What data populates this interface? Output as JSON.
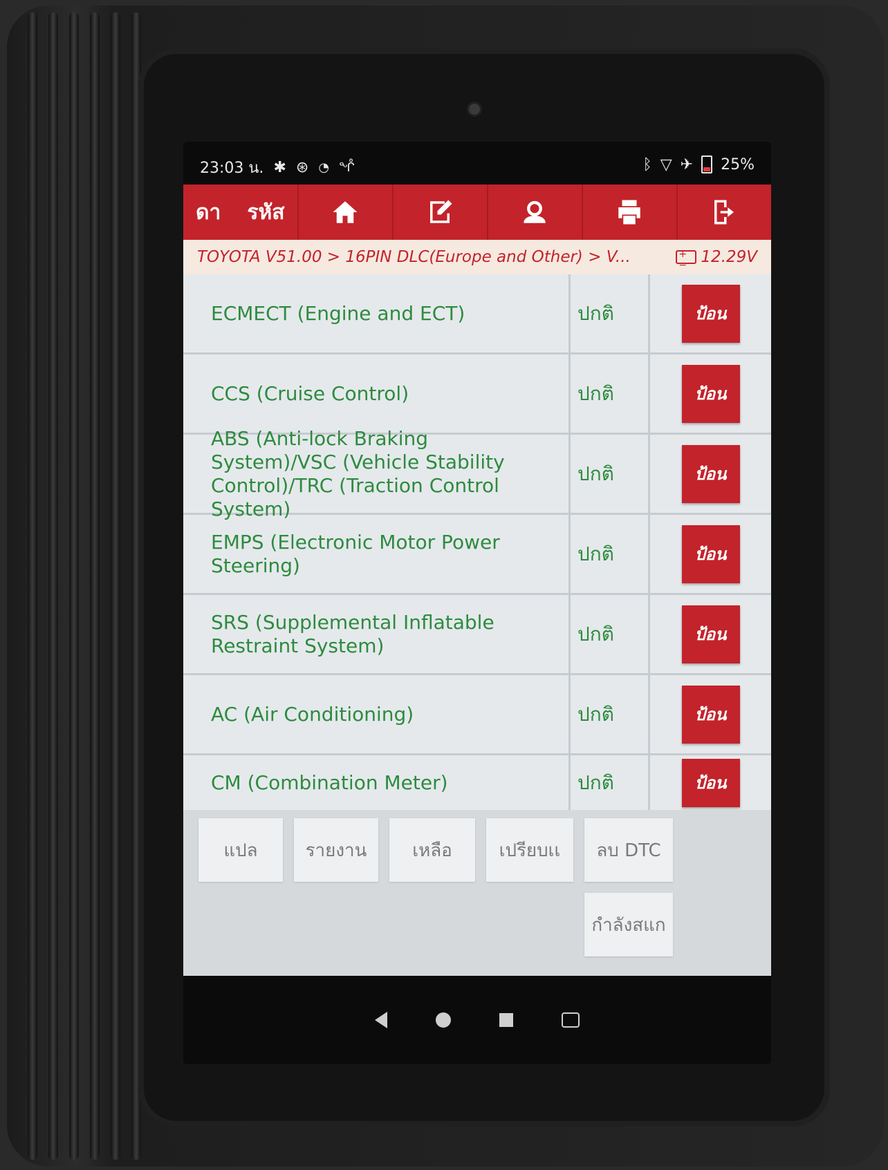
{
  "status": {
    "time": "23:03 น.",
    "battery": "25%",
    "icons_left": [
      "gear-icon",
      "steering-icon",
      "wifi-icon",
      "stethoscope-icon"
    ],
    "icons_right": [
      "bluetooth-icon",
      "signal-icon",
      "airplane-icon",
      "battery-icon"
    ]
  },
  "toolbar": {
    "left_label_1": "ดา",
    "left_label_2": "รหัส",
    "buttons": [
      "home-icon",
      "edit-note-icon",
      "user-support-icon",
      "printer-icon",
      "exit-icon"
    ]
  },
  "breadcrumb": {
    "path": "TOYOTA V51.00 > 16PIN DLC(Europe and Other) > V...",
    "voltage": "12.29V"
  },
  "systems": [
    {
      "name": "ECMECT (Engine and ECT)",
      "status": "ปกติ",
      "action": "ป้อน"
    },
    {
      "name": "CCS (Cruise Control)",
      "status": "ปกติ",
      "action": "ป้อน"
    },
    {
      "name": "ABS (Anti-lock Braking System)/VSC (Vehicle Stability Control)/TRC (Traction Control System)",
      "status": "ปกติ",
      "action": "ป้อน"
    },
    {
      "name": "EMPS (Electronic Motor Power Steering)",
      "status": "ปกติ",
      "action": "ป้อน"
    },
    {
      "name": "SRS (Supplemental Inflatable Restraint System)",
      "status": "ปกติ",
      "action": "ป้อน"
    },
    {
      "name": "AC (Air Conditioning)",
      "status": "ปกติ",
      "action": "ป้อน"
    },
    {
      "name": "CM (Combination Meter)",
      "status": "ปกติ",
      "action": "ป้อน"
    }
  ],
  "actions": {
    "translate": "แปล",
    "report": "รายงาน",
    "help": "เหลือ",
    "compare": "เปรียบเเ",
    "clear_dtc": "ลบ DTC",
    "scanning": "กำลังสแก"
  },
  "colors": {
    "brand_red": "#c3232b",
    "system_green": "#2e8b3e",
    "breadcrumb_bg": "#f6e9df"
  }
}
